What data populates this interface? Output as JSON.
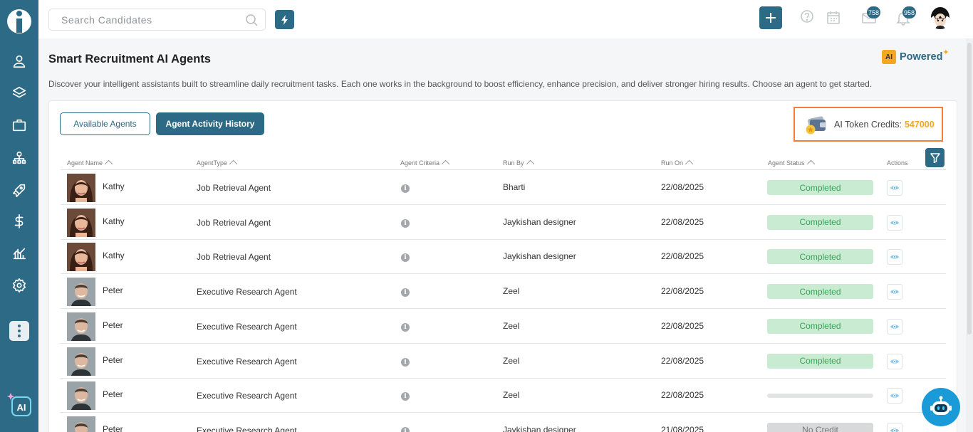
{
  "search": {
    "placeholder": "Search Candidates"
  },
  "header": {
    "mail_count": "758",
    "notification_count": "958"
  },
  "page": {
    "title": "Smart Recruitment AI Agents",
    "ai_badge": "AI",
    "ai_powered": "Powered",
    "description": "Discover your intelligent assistants built to streamline daily recruitment tasks. Each one works in the background to boost efficiency, enhance precision, and deliver stronger hiring results. Choose an agent to get started."
  },
  "tabs": {
    "available": "Available Agents",
    "history": "Agent Activity History"
  },
  "credits": {
    "label": "AI Token Credits:",
    "value": "547000"
  },
  "table": {
    "columns": [
      "Agent Name",
      "AgentType",
      "Agent Criteria",
      "Run By",
      "Run On",
      "Agent Status",
      "Actions"
    ],
    "rows": [
      {
        "name": "Kathy",
        "type": "Job Retrieval Agent",
        "run_by": "Bharti",
        "run_on": "22/08/2025",
        "status": "Completed",
        "avatar": "woman"
      },
      {
        "name": "Kathy",
        "type": "Job Retrieval Agent",
        "run_by": "Jaykishan designer",
        "run_on": "22/08/2025",
        "status": "Completed",
        "avatar": "woman"
      },
      {
        "name": "Kathy",
        "type": "Job Retrieval Agent",
        "run_by": "Jaykishan designer",
        "run_on": "22/08/2025",
        "status": "Completed",
        "avatar": "woman"
      },
      {
        "name": "Peter",
        "type": "Executive Research Agent",
        "run_by": "Zeel",
        "run_on": "22/08/2025",
        "status": "Completed",
        "avatar": "man"
      },
      {
        "name": "Peter",
        "type": "Executive Research Agent",
        "run_by": "Zeel",
        "run_on": "22/08/2025",
        "status": "Completed",
        "avatar": "man"
      },
      {
        "name": "Peter",
        "type": "Executive Research Agent",
        "run_by": "Zeel",
        "run_on": "22/08/2025",
        "status": "Completed",
        "avatar": "man"
      },
      {
        "name": "Peter",
        "type": "Executive Research Agent",
        "run_by": "Zeel",
        "run_on": "22/08/2025",
        "status": "",
        "avatar": "man"
      },
      {
        "name": "Peter",
        "type": "Executive Research Agent",
        "run_by": "Jaykishan designer",
        "run_on": "21/08/2025",
        "status": "No Credit",
        "avatar": "man"
      }
    ]
  },
  "colors": {
    "primary": "#2d6a85",
    "accent": "#f5a623",
    "highlight": "#f07f38",
    "success_bg": "#c9ebd1",
    "success_text": "#3aa35b"
  },
  "icons": {
    "sidebar": [
      "user-icon",
      "layers-icon",
      "briefcase-icon",
      "org-chart-icon",
      "rocket-icon",
      "dollar-icon",
      "analytics-icon",
      "settings-icon"
    ],
    "topbar": [
      "help-icon",
      "calendar-icon",
      "mail-icon",
      "bell-icon"
    ]
  }
}
